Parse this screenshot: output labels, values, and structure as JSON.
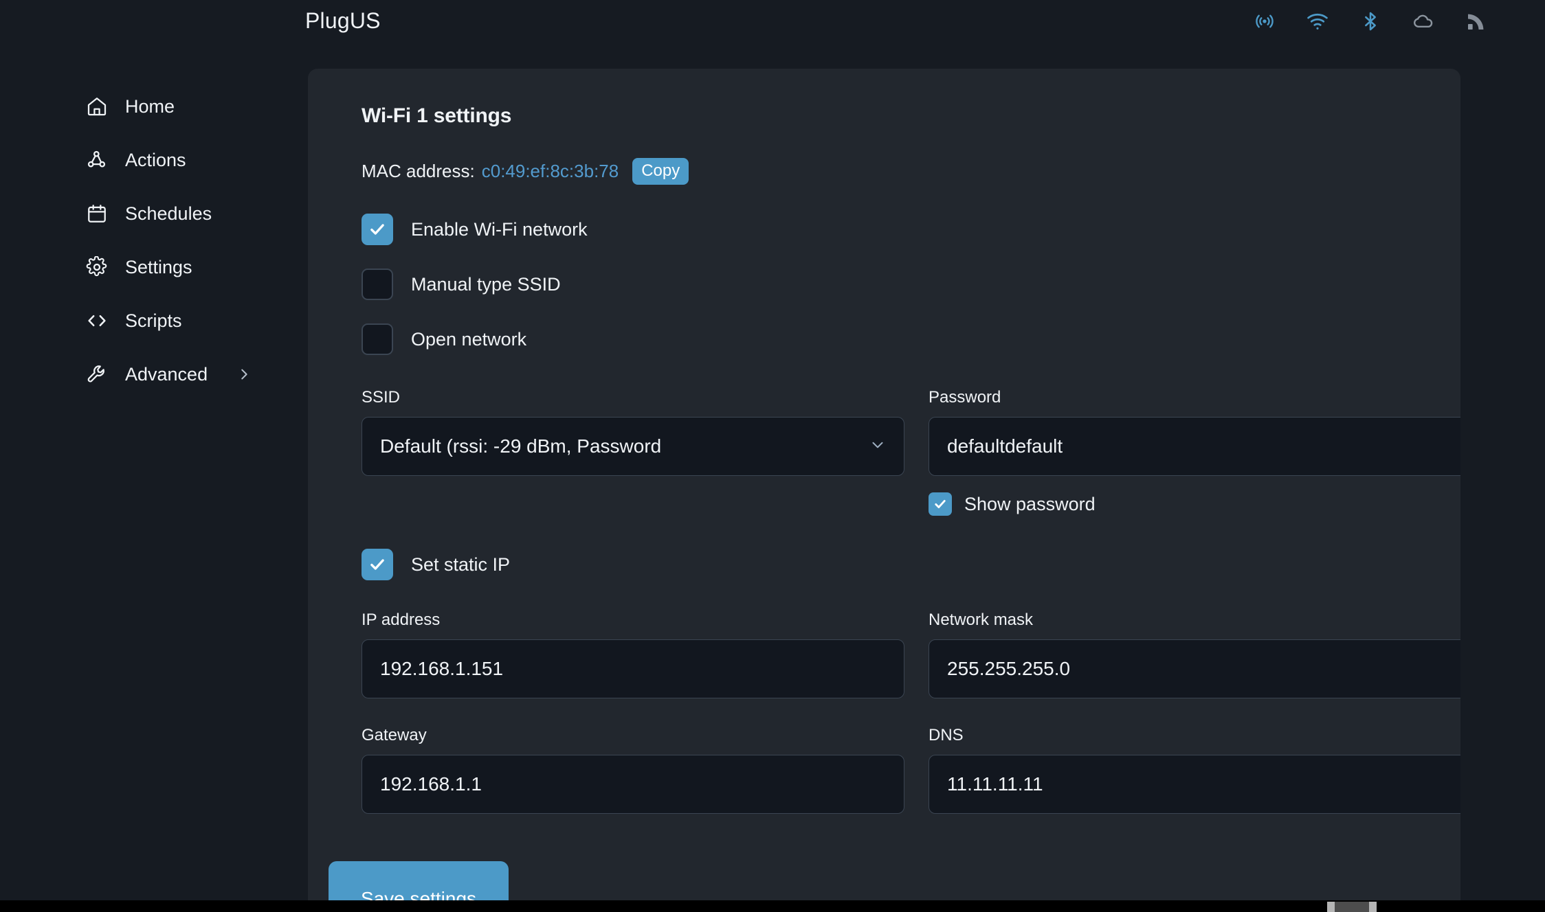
{
  "header": {
    "app_title": "PlugUS",
    "status_icons": [
      {
        "name": "broadcast-icon",
        "color": "#4c9ac8"
      },
      {
        "name": "wifi-icon",
        "color": "#4c9ac8"
      },
      {
        "name": "bluetooth-icon",
        "color": "#4c9ac8"
      },
      {
        "name": "cloud-icon",
        "color": "#8b949e"
      },
      {
        "name": "rss-icon",
        "color": "#8b949e"
      }
    ]
  },
  "sidebar": {
    "items": [
      {
        "label": "Home",
        "icon": "home-icon",
        "has_chevron": false
      },
      {
        "label": "Actions",
        "icon": "actions-webhook-icon",
        "has_chevron": false
      },
      {
        "label": "Schedules",
        "icon": "calendar-icon",
        "has_chevron": false
      },
      {
        "label": "Settings",
        "icon": "gear-icon",
        "has_chevron": false
      },
      {
        "label": "Scripts",
        "icon": "code-brackets-icon",
        "has_chevron": false
      },
      {
        "label": "Advanced",
        "icon": "wrench-icon",
        "has_chevron": true
      }
    ]
  },
  "main": {
    "title": "Wi-Fi 1 settings",
    "mac": {
      "label": "MAC address:",
      "value": "c0:49:ef:8c:3b:78",
      "copy_label": "Copy"
    },
    "checkboxes": [
      {
        "label": "Enable Wi-Fi network",
        "checked": true
      },
      {
        "label": "Manual type SSID",
        "checked": false
      },
      {
        "label": "Open network",
        "checked": false
      }
    ],
    "ssid": {
      "label": "SSID",
      "value": "Default (rssi: -29 dBm, Password"
    },
    "password": {
      "label": "Password",
      "value": "defaultdefault",
      "show_password_label": "Show password",
      "show_password_checked": true
    },
    "static_ip": {
      "label": "Set static IP",
      "checked": true
    },
    "ip_address": {
      "label": "IP address",
      "value": "192.168.1.151"
    },
    "network_mask": {
      "label": "Network mask",
      "value": "255.255.255.0"
    },
    "gateway": {
      "label": "Gateway",
      "value": "192.168.1.1"
    },
    "dns": {
      "label": "DNS",
      "value": "11.11.11.11"
    },
    "save_label": "Save settings"
  },
  "colors": {
    "accent": "#4c9ac8",
    "page_bg": "#161b22",
    "card_bg": "#22272e",
    "input_bg": "#12171f",
    "link": "#539bcf"
  }
}
